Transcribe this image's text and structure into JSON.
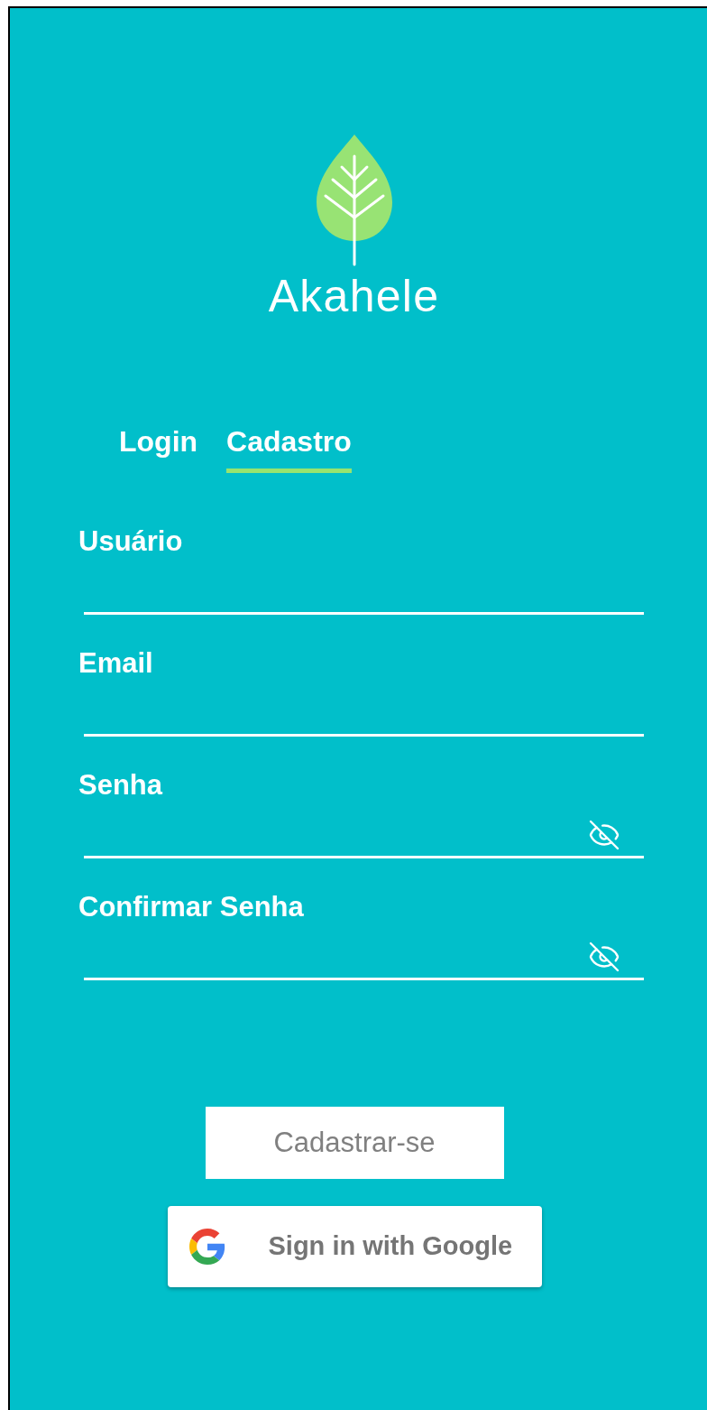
{
  "logo": {
    "name": "Akahele"
  },
  "tabs": [
    {
      "label": "Login",
      "selected": false
    },
    {
      "label": "Cadastro",
      "selected": true
    }
  ],
  "fields": [
    {
      "label": "Usuário",
      "kind": "text"
    },
    {
      "label": "Email",
      "kind": "text"
    },
    {
      "label": "Senha",
      "kind": "password"
    },
    {
      "label": "Confirmar Senha",
      "kind": "password"
    }
  ],
  "submit_button": {
    "label": "Cadastrar-se"
  },
  "google_button": {
    "label": "Sign in with Google"
  }
}
